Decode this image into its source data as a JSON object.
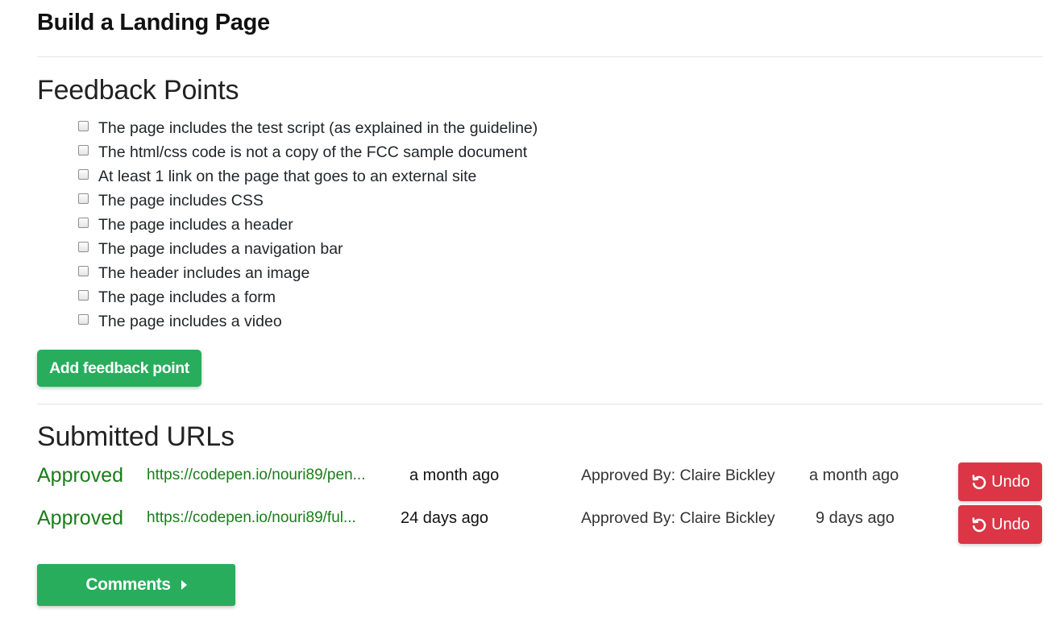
{
  "page": {
    "title": "Build a Landing Page"
  },
  "feedback": {
    "heading": "Feedback Points",
    "points": [
      "The page includes the test script (as explained in the guideline)",
      "The html/css code is not a copy of the FCC sample document",
      "At least 1 link on the page that goes to an external site",
      "The page includes CSS",
      "The page includes a header",
      "The page includes a navigation bar",
      "The header includes an image",
      "The page includes a form",
      "The page includes a video"
    ],
    "add_button_label": "Add feedback point"
  },
  "submitted": {
    "heading": "Submitted URLs",
    "rows": [
      {
        "status": "Approved",
        "url": "https://codepen.io/nouri89/pen...",
        "created": "a month ago",
        "approved_by": "Approved By: Claire Bickley",
        "approved_time": "a month ago",
        "undo_label": "Undo"
      },
      {
        "status": "Approved",
        "url": "https://codepen.io/nouri89/ful...",
        "created": "24 days ago",
        "approved_by": "Approved By: Claire Bickley",
        "approved_time": "9 days ago",
        "undo_label": "Undo"
      }
    ]
  },
  "comments_button_label": "Comments",
  "icons": {
    "undo": "undo-icon",
    "comments_caret": "caret-right-icon",
    "checkbox": "checkbox-unchecked"
  },
  "colors": {
    "green_button": "#28ad5c",
    "approved_text": "#1a7d1a",
    "undo_button": "#dc3545",
    "divider": "#e3e3e3"
  }
}
